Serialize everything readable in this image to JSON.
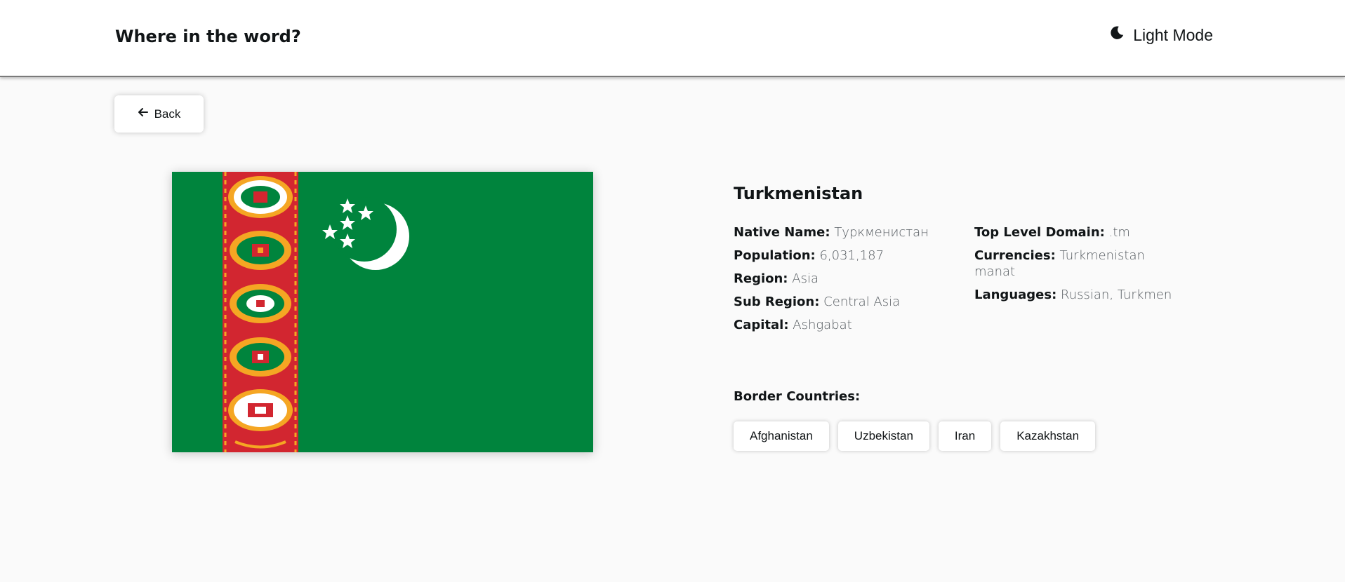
{
  "header": {
    "title": "Where in the word?",
    "theme_label": "Light Mode",
    "theme_icon": "moon-icon"
  },
  "back_button": {
    "label": "Back",
    "icon": "arrow-left-icon"
  },
  "flag": {
    "alt_country": "Turkmenistan",
    "colors": {
      "green": "#00843D",
      "red": "#D22630",
      "white": "#FFFFFF",
      "gold": "#F5A623"
    }
  },
  "country": {
    "name": "Turkmenistan",
    "native_name_label": "Native Name:",
    "native_name": "Туркменистан",
    "population_label": "Population:",
    "population": "6,031,187",
    "region_label": "Region:",
    "region": "Asia",
    "sub_region_label": "Sub Region:",
    "sub_region": "Central Asia",
    "capital_label": "Capital:",
    "capital": "Ashgabat",
    "tld_label": "Top Level Domain:",
    "tld": ".tm",
    "currencies_label": "Currencies:",
    "currencies": "Turkmenistan manat",
    "languages_label": "Languages:",
    "languages": "Russian, Turkmen"
  },
  "borders": {
    "title": "Border Countries:",
    "items": [
      "Afghanistan",
      "Uzbekistan",
      "Iran",
      "Kazakhstan"
    ]
  }
}
